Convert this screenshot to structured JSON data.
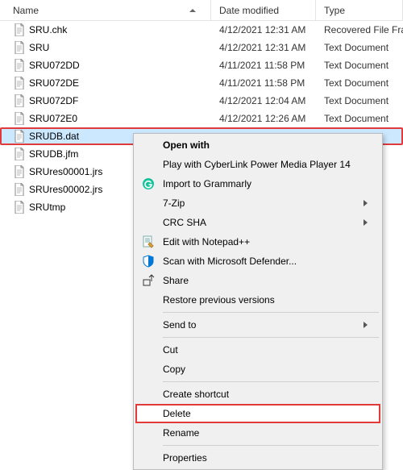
{
  "columns": {
    "name": "Name",
    "date": "Date modified",
    "type": "Type"
  },
  "files": [
    {
      "name": "SRU.chk",
      "date": "4/12/2021 12:31 AM",
      "type": "Recovered File Fragments"
    },
    {
      "name": "SRU",
      "date": "4/12/2021 12:31 AM",
      "type": "Text Document"
    },
    {
      "name": "SRU072DD",
      "date": "4/11/2021 11:58 PM",
      "type": "Text Document"
    },
    {
      "name": "SRU072DE",
      "date": "4/11/2021 11:58 PM",
      "type": "Text Document"
    },
    {
      "name": "SRU072DF",
      "date": "4/12/2021 12:04 AM",
      "type": "Text Document"
    },
    {
      "name": "SRU072E0",
      "date": "4/12/2021 12:26 AM",
      "type": "Text Document"
    },
    {
      "name": "SRUDB.dat",
      "date": "",
      "type": ""
    },
    {
      "name": "SRUDB.jfm",
      "date": "",
      "type": ""
    },
    {
      "name": "SRUres00001.jrs",
      "date": "",
      "type": ""
    },
    {
      "name": "SRUres00002.jrs",
      "date": "",
      "type": ""
    },
    {
      "name": "SRUtmp",
      "date": "",
      "type": ""
    }
  ],
  "menu": {
    "open_with": "Open with",
    "play_cyberlink": "Play with CyberLink Power Media Player 14",
    "import_grammarly": "Import to Grammarly",
    "seven_zip": "7-Zip",
    "crc_sha": "CRC SHA",
    "edit_notepad": "Edit with Notepad++",
    "scan_defender": "Scan with Microsoft Defender...",
    "share": "Share",
    "restore": "Restore previous versions",
    "send_to": "Send to",
    "cut": "Cut",
    "copy": "Copy",
    "create_shortcut": "Create shortcut",
    "delete": "Delete",
    "rename": "Rename",
    "properties": "Properties"
  }
}
